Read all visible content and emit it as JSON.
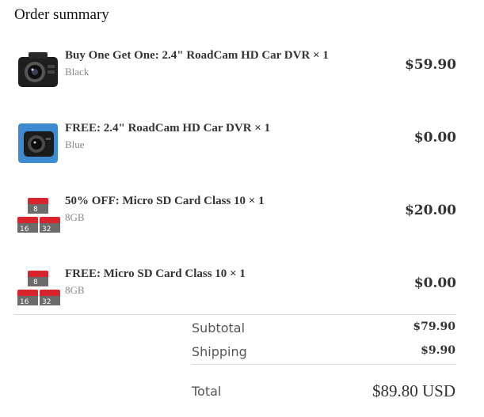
{
  "heading": "Order summary",
  "items": [
    {
      "title": "Buy One Get One: 2.4\" RoadCam HD Car DVR × 1",
      "variant": "Black",
      "price": "$59.90",
      "image_icon": "dashcam-black-icon"
    },
    {
      "title": "FREE: 2.4\" RoadCam HD Car DVR × 1",
      "variant": "Blue",
      "price": "$0.00",
      "image_icon": "dashcam-blue-icon"
    },
    {
      "title": "50% OFF: Micro SD Card Class 10 × 1",
      "variant": "8GB",
      "price": "$20.00",
      "image_icon": "sd-cards-icon"
    },
    {
      "title": "FREE: Micro SD Card Class 10 × 1",
      "variant": "8GB",
      "price": "$0.00",
      "image_icon": "sd-cards-icon"
    }
  ],
  "summary": {
    "subtotal_label": "Subtotal",
    "subtotal_value": "$79.90",
    "shipping_label": "Shipping",
    "shipping_value": "$9.90",
    "total_label": "Total",
    "total_value": "$89.80 USD"
  },
  "sd_labels": [
    "8",
    "16",
    "32"
  ],
  "colors": {
    "sd_red": "#d8252b",
    "sd_grey": "#6b6b6b",
    "cam_blue": "#3d8ad1",
    "cam_black": "#222222"
  }
}
